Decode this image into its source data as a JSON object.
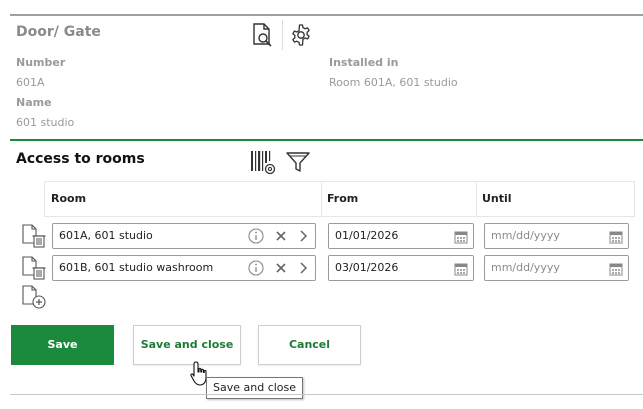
{
  "door": {
    "title": "Door/ Gate",
    "number_label": "Number",
    "number_value": "601A",
    "name_label": "Name",
    "name_value": "601 studio",
    "installed_label": "Installed in",
    "installed_value": "Room 601A, 601 studio",
    "icons": [
      "document-search-icon",
      "gear-icon"
    ]
  },
  "access": {
    "title": "Access to rooms",
    "icons": [
      "barcode-settings-icon",
      "filter-icon"
    ],
    "columns": {
      "room": "Room",
      "from": "From",
      "until": "Until"
    },
    "rows": [
      {
        "room": "601A, 601 studio",
        "from": "01/01/2026",
        "until_placeholder": "mm/dd/yyyy"
      },
      {
        "room": "601B, 601 studio washroom",
        "from": "03/01/2026",
        "until_placeholder": "mm/dd/yyyy"
      }
    ]
  },
  "buttons": {
    "save": "Save",
    "save_and_close": "Save and close",
    "cancel": "Cancel"
  },
  "tooltip": "Save and close",
  "colors": {
    "accent_green": "#1c8a3c",
    "muted_text": "#9a9a9a",
    "divider": "#a0a0a0"
  }
}
